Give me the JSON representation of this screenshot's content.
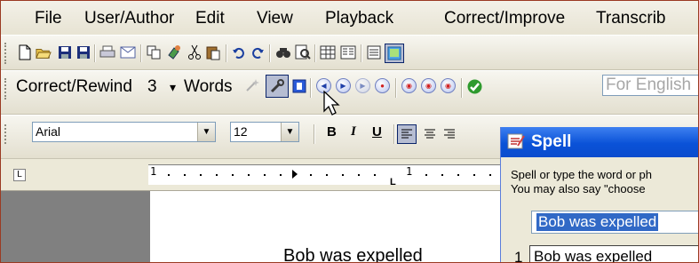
{
  "menubar": {
    "items": [
      {
        "label": "File"
      },
      {
        "label": "User/Author"
      },
      {
        "label": "Edit"
      },
      {
        "label": "View"
      },
      {
        "label": "Playback"
      },
      {
        "label": "Correct/Improve"
      },
      {
        "label": "Transcrib"
      }
    ]
  },
  "toolbar_standard": {
    "icons": [
      "new-icon",
      "open-icon",
      "save-icon",
      "save-all-icon",
      "print-icon",
      "mail-icon",
      "copy-icon",
      "paint-icon",
      "cut-icon",
      "paste-icon",
      "undo-icon",
      "redo-icon",
      "find-icon",
      "preview-icon",
      "table-icon",
      "columns-icon",
      "doc-map-icon",
      "monitor-icon"
    ]
  },
  "toolbar_correct": {
    "mode_label": "Correct/Rewind",
    "count": "3",
    "dropdown_arrow": "▾",
    "unit_label": "Words",
    "language_placeholder": "For English"
  },
  "toolbar_format": {
    "font": "Arial",
    "size": "12",
    "bold": "B",
    "italic": "I",
    "underline": "U"
  },
  "ruler": {
    "tab_symbol": "L",
    "marks": [
      "1",
      "1"
    ]
  },
  "document": {
    "text": "Bob was expelled"
  },
  "spell_dialog": {
    "title": "Spell",
    "instruction_1": "Spell or type the word or ph",
    "instruction_2": "You may also say \"choose",
    "input_value": "Bob was expelled",
    "choice_number": "1",
    "choice_text": "Bob was expelled"
  },
  "colors": {
    "title_bar": "#0a52d8",
    "selection": "#3169c6",
    "window_border": "#9a3a22"
  }
}
